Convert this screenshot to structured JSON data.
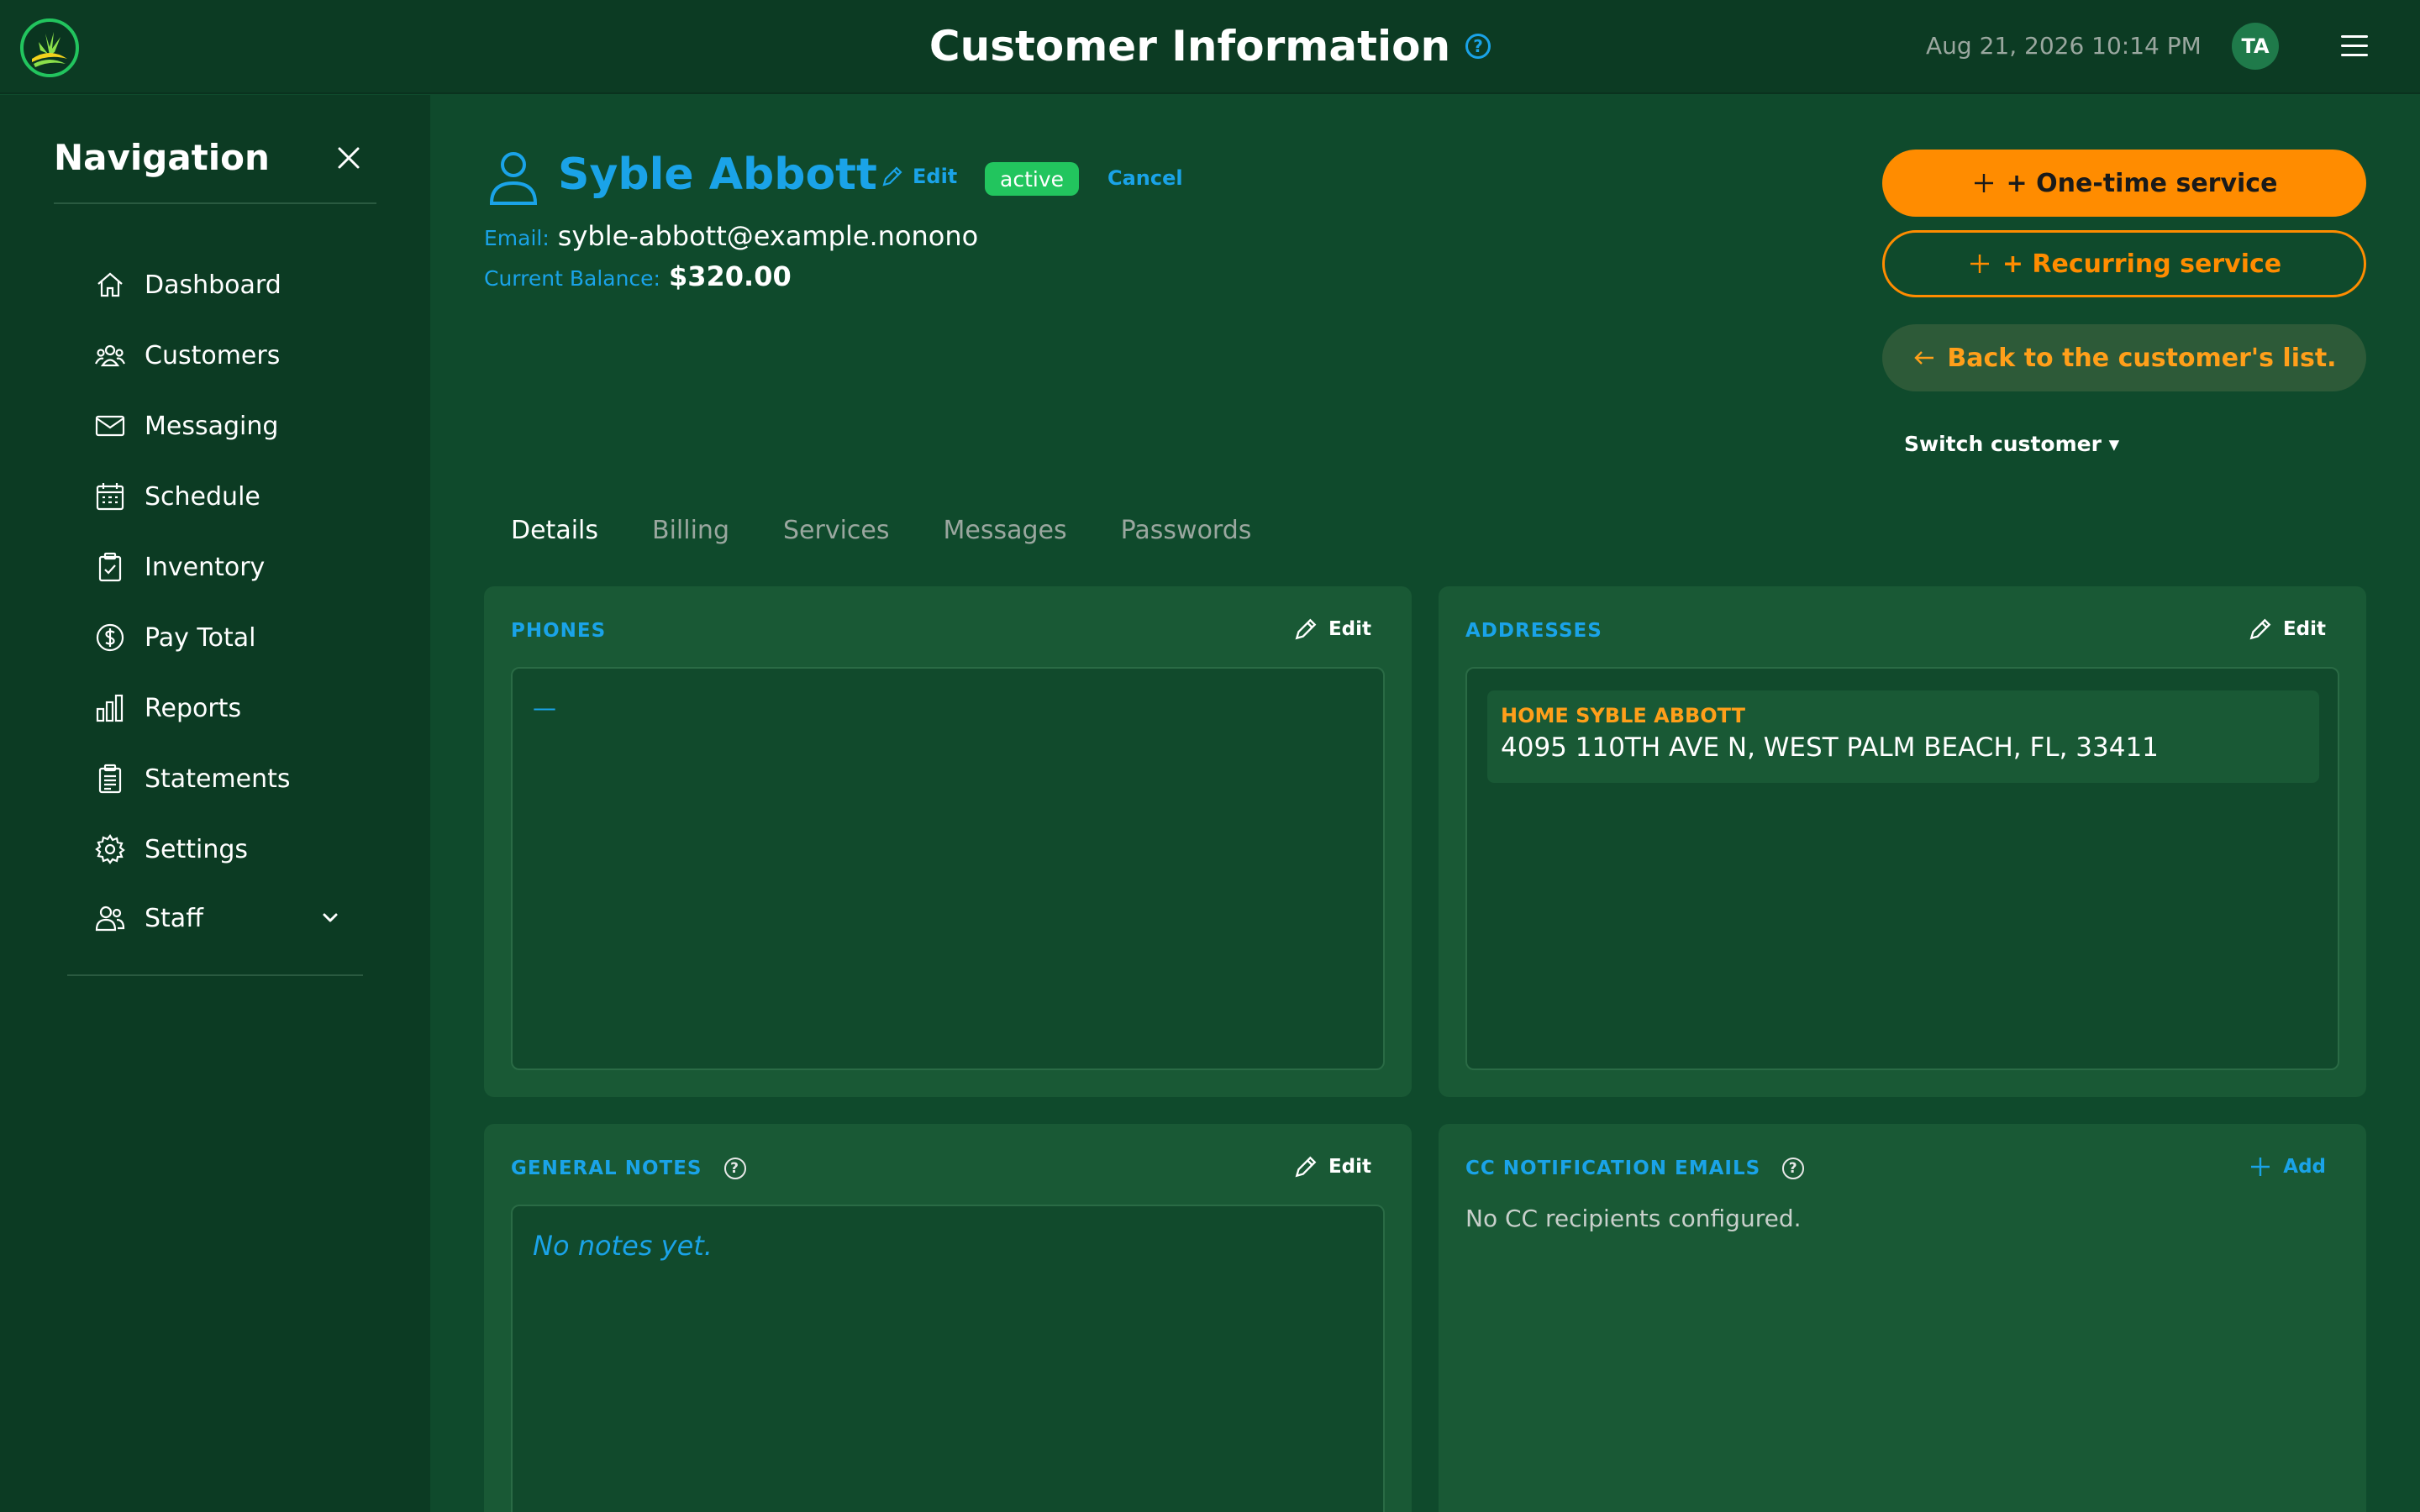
{
  "header": {
    "title": "Customer Information",
    "datetime": "Aug 21, 2026 10:14 PM",
    "avatar_initials": "TA",
    "help_icon": "question-circle-icon",
    "menu_icon": "hamburger-menu-icon"
  },
  "sidebar": {
    "title": "Navigation",
    "items": [
      {
        "label": "Dashboard",
        "icon": "home-icon"
      },
      {
        "label": "Customers",
        "icon": "users-icon"
      },
      {
        "label": "Messaging",
        "icon": "mail-icon"
      },
      {
        "label": "Schedule",
        "icon": "calendar-icon"
      },
      {
        "label": "Inventory",
        "icon": "clipboard-check-icon"
      },
      {
        "label": "Pay Total",
        "icon": "dollar-circle-icon"
      },
      {
        "label": "Reports",
        "icon": "bar-chart-icon"
      },
      {
        "label": "Statements",
        "icon": "document-icon"
      },
      {
        "label": "Settings",
        "icon": "gear-icon"
      },
      {
        "label": "Staff",
        "icon": "staff-icon"
      }
    ]
  },
  "customer": {
    "name": "Syble Abbott",
    "edit_label": "Edit",
    "status": "active",
    "cancel_label": "Cancel",
    "email_label": "Email:",
    "email": "syble-abbott@example.nonono",
    "balance_label": "Current Balance:",
    "balance": "$320.00"
  },
  "actions": {
    "one_time": "+ One-time service",
    "recurring": "+ Recurring service",
    "back": "Back to the customer's list.",
    "switch": "Switch customer ▾"
  },
  "tabs": [
    "Details",
    "Billing",
    "Services",
    "Messages",
    "Passwords"
  ],
  "cards": {
    "phones": {
      "title": "PHONES",
      "action": "Edit",
      "empty": "—"
    },
    "addresses": {
      "title": "ADDRESSES",
      "action": "Edit",
      "items": [
        {
          "label": "HOME SYBLE ABBOTT",
          "line": "4095 110TH AVE N, WEST PALM BEACH, FL, 33411"
        }
      ]
    },
    "notes": {
      "title": "GENERAL NOTES",
      "action": "Edit",
      "empty": "No notes yet."
    },
    "cc": {
      "title": "CC NOTIFICATION EMAILS",
      "action": "Add",
      "empty": "No CC recipients configured."
    }
  },
  "colors": {
    "background": "#0f4a2c",
    "sidebar": "#0c3b23",
    "card": "#195935",
    "accent_blue": "#1aa3e8",
    "accent_orange": "#ff8c00",
    "status_green": "#22c55e"
  }
}
